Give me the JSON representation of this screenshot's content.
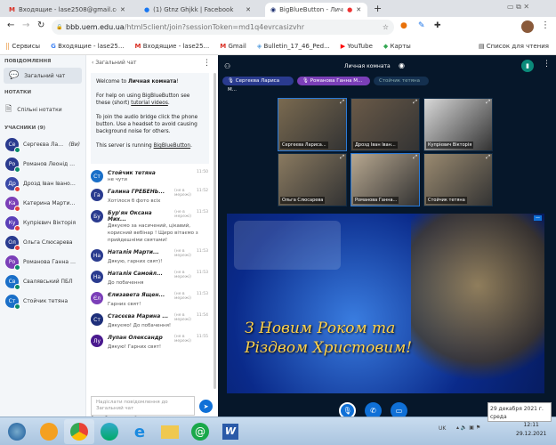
{
  "browser": {
    "tabs": [
      {
        "title": "Входящие - lase2508@gmail.com",
        "active": false
      },
      {
        "title": "(1) Gtnz Ghjkk | Facebook",
        "active": false
      },
      {
        "title": "BigBlueButton - Личная комната",
        "active": true
      }
    ],
    "url_domain": "bbb.uem.edu.ua",
    "url_path": "/html5client/join?sessionToken=md1q4evrcasizvhr",
    "bookmarks": [
      "Сервисы",
      "Входящие - lase25...",
      "Входящие - lase25...",
      "Gmail",
      "Bulletin_17_46_Ped...",
      "YouTube",
      "Карты"
    ],
    "reading_list": "Список для чтения"
  },
  "sidebar": {
    "messages_header": "ПОВІДОМЛЕННЯ",
    "public_chat": "Загальний чат",
    "notes_header": "НОТАТКИ",
    "shared_notes": "Спільні нотатки",
    "users_header": "УЧАСНИКИ (9)",
    "users": [
      {
        "initials": "Се",
        "name": "Сергеєва Лариса ...",
        "suffix": "(Ви)",
        "color": "#2a3b8f",
        "status": "#0a8a6a"
      },
      {
        "initials": "Ро",
        "name": "Романов Леонід Анато...",
        "suffix": "",
        "color": "#2a3b8f",
        "status": "#0a8a6a"
      },
      {
        "initials": "Др",
        "name": "Дрозд Іван Іванович",
        "suffix": "",
        "color": "#3a4aa8",
        "status": "#e04040"
      },
      {
        "initials": "Ка",
        "name": "Катерина Мартиненко",
        "suffix": "",
        "color": "#7b3fb8",
        "status": "#e04040"
      },
      {
        "initials": "Ку",
        "name": "Купрієвич Вікторія",
        "suffix": "",
        "color": "#5a3fb8",
        "status": "#e04040"
      },
      {
        "initials": "Ол",
        "name": "Ольга Слюсарева",
        "suffix": "",
        "color": "#2a3b8f",
        "status": "#e04040"
      },
      {
        "initials": "Ро",
        "name": "Романова Ганна Мико...",
        "suffix": "",
        "color": "#7b3fb8",
        "status": "#0a8a6a"
      },
      {
        "initials": "Св",
        "name": "Свалявський ПБЛ",
        "suffix": "",
        "color": "#1a6fc8",
        "status": "#0a8a6a"
      },
      {
        "initials": "Ст",
        "name": "Стойчик тетяна",
        "suffix": "",
        "color": "#1a6fc8",
        "status": "#0a8a6a"
      }
    ]
  },
  "chat": {
    "title": "Загальний чат",
    "welcome": {
      "l1a": "Welcome to ",
      "l1b": "Личная комната",
      "l1c": "!",
      "l2a": "For help on using BigBlueButton see these (short) ",
      "l2link": "tutorial videos",
      "l2c": ".",
      "l3": "To join the audio bridge click the phone button. Use a headset to avoid causing background noise for others.",
      "l4a": "This server is running ",
      "l4link": "BigBlueButton",
      "l4c": "."
    },
    "messages": [
      {
        "initials": "Ст",
        "name": "Стойчик тетяна",
        "offline": "",
        "time": "11:50",
        "text": "не чути",
        "color": "#1a6fc8"
      },
      {
        "initials": "Га",
        "name": "Галина ГРЕБЕНЬ...",
        "offline": "(не в мережі)",
        "time": "11:52",
        "text": "Хотілося б фото всіх",
        "color": "#2a3b8f"
      },
      {
        "initials": "Бу",
        "name": "Бур'ян Оксана Мих...",
        "offline": "(не в мережі)",
        "time": "11:53",
        "text": "Дякуємо за насичений, цікавий, корисний вебінар ! Щиро вітаємо з прийдешніми святами!",
        "color": "#2a3b8f"
      },
      {
        "initials": "На",
        "name": "Наталія Марти...",
        "offline": "(не в мережі)",
        "time": "11:53",
        "text": "Дякую, гарних свят)!",
        "color": "#2a3b8f"
      },
      {
        "initials": "На",
        "name": "Наталія Самойл...",
        "offline": "(не в мережі)",
        "time": "11:53",
        "text": "До побачення",
        "color": "#2a3b8f"
      },
      {
        "initials": "Єл",
        "name": "Єлизавета Ящен...",
        "offline": "(не в мережі)",
        "time": "11:53",
        "text": "Гарних свят!",
        "color": "#7b3fb8"
      },
      {
        "initials": "Ст",
        "name": "Стасєєва Марина ...",
        "offline": "(не в мережі)",
        "time": "11:54",
        "text": "Дякуємо! До побачення!",
        "color": "#1e2f7a"
      },
      {
        "initials": "Лу",
        "name": "Лупан Олександр",
        "offline": "(не в мережі)",
        "time": "11:55",
        "text": "Дякую! Гарних свят!",
        "color": "#4a1a8f"
      }
    ],
    "input_placeholder": "Надіслати повідомлення до Загальний чат",
    "typing": "Ольга Слюсарева набирає"
  },
  "main": {
    "room_title": "Личная комната",
    "talkers": [
      {
        "name": "Сергеєва Лариса М...",
        "color": "#2a3b8f"
      },
      {
        "name": "Романова Ганна М...",
        "color": "#7b3fb8"
      },
      {
        "name": "Стойчик тетяна",
        "color": "#14304f"
      }
    ],
    "videos": [
      "Сергеєва Лариса...",
      "Дрозд Іван Іван...",
      "Купрієвич Вікторія",
      "Ольга Слюсарева",
      "Романова Ганна...",
      "Стойчик тетяна"
    ],
    "slide_text": "З Новим Роком та Різдвом Христовим!"
  },
  "taskbar": {
    "lang": "UK",
    "time": "12:11",
    "date": "29.12.2021",
    "tooltip_date": "29 декабря 2021 г.",
    "tooltip_day": "среда"
  }
}
